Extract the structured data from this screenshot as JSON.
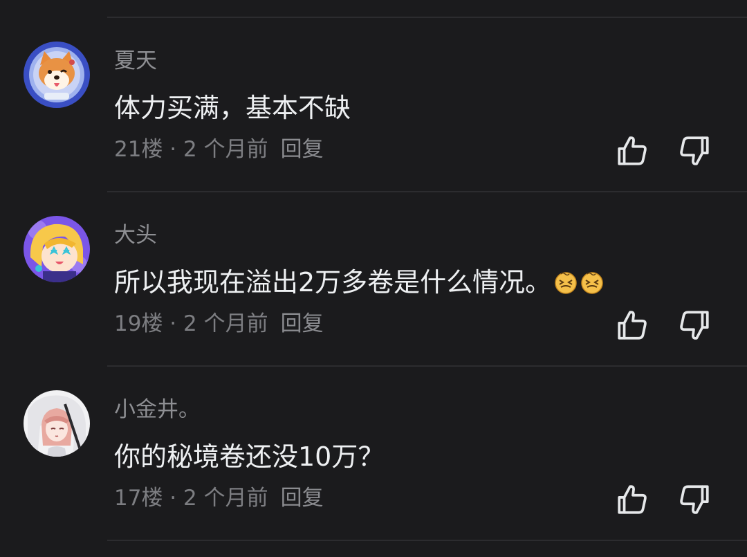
{
  "comments": [
    {
      "username": "夏天",
      "text": "体力买满，基本不缺",
      "floor": "21楼",
      "time": "2 个月前",
      "reply_label": "回复",
      "avatar": "shiba-dog-avatar",
      "emojis": []
    },
    {
      "username": "大头",
      "text": "所以我现在溢出2万多卷是什么情况。",
      "floor": "19楼",
      "time": "2 个月前",
      "reply_label": "回复",
      "avatar": "anime-yellow-hair-avatar",
      "emojis": [
        "dizzy-face-emoji",
        "dizzy-face-emoji"
      ]
    },
    {
      "username": "小金井。",
      "text": "你的秘境卷还没10万？",
      "floor": "17楼",
      "time": "2 个月前",
      "reply_label": "回复",
      "avatar": "anime-pink-hair-avatar",
      "emojis": []
    }
  ],
  "separator": " · ",
  "icons": {
    "like": "thumbs-up-icon",
    "dislike": "thumbs-down-icon"
  },
  "colors": {
    "background": "#1b1b1d",
    "text": "#eef0f2",
    "muted": "#8e8f93",
    "divider": "#2c2c2f"
  }
}
